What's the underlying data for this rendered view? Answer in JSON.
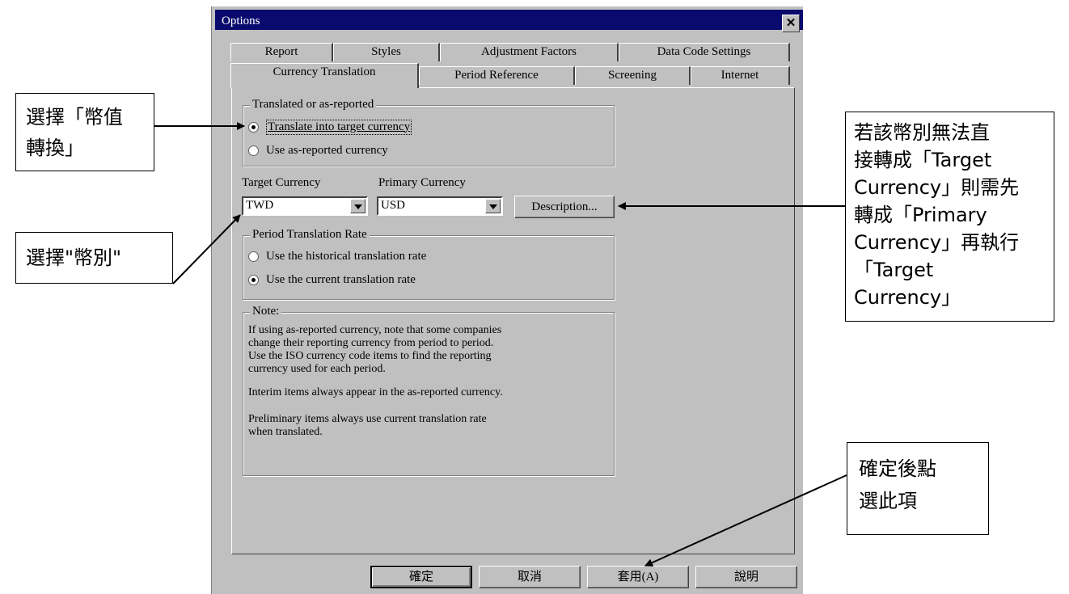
{
  "dialog": {
    "title": "Options",
    "close_glyph": "✕",
    "tabs_row1": [
      "Report",
      "Styles",
      "Adjustment Factors",
      "Data Code Settings"
    ],
    "tabs_row2": [
      "Currency Translation",
      "Period Reference",
      "Screening",
      "Internet"
    ],
    "active_tab": "Currency Translation",
    "translated_group": {
      "title": "Translated or as-reported",
      "options": [
        {
          "label": "Translate into target currency",
          "selected": true
        },
        {
          "label": "Use as-reported currency",
          "selected": false
        }
      ]
    },
    "target_currency": {
      "label": "Target Currency",
      "value": "TWD"
    },
    "primary_currency": {
      "label": "Primary Currency",
      "value": "USD"
    },
    "description_button": "Description...",
    "rate_group": {
      "title": "Period Translation Rate",
      "options": [
        {
          "label": "Use the historical translation rate",
          "selected": false
        },
        {
          "label": "Use the current translation rate",
          "selected": true
        }
      ]
    },
    "note_group": {
      "title": "Note:",
      "paragraphs": [
        "If using as-reported currency, note that some companies\nchange their reporting currency from period to period.\nUse the ISO currency code items to find the reporting\ncurrency used for each period.",
        "Interim items always appear in the as-reported currency.",
        "Preliminary items always use current  translation rate\nwhen translated."
      ]
    },
    "buttons": {
      "ok": "確定",
      "cancel": "取消",
      "apply": "套用(A)",
      "help": "說明"
    }
  },
  "callouts": {
    "select_translation": "選擇「幣值\n轉換」",
    "select_currency": "選擇\"幣別\"",
    "primary_note": "若該幣別無法直\n接轉成「Target\nCurrency」則需先\n轉成「Primary\nCurrency」再執行\n「Target\nCurrency」",
    "click_apply": "確定後點\n選此項"
  }
}
